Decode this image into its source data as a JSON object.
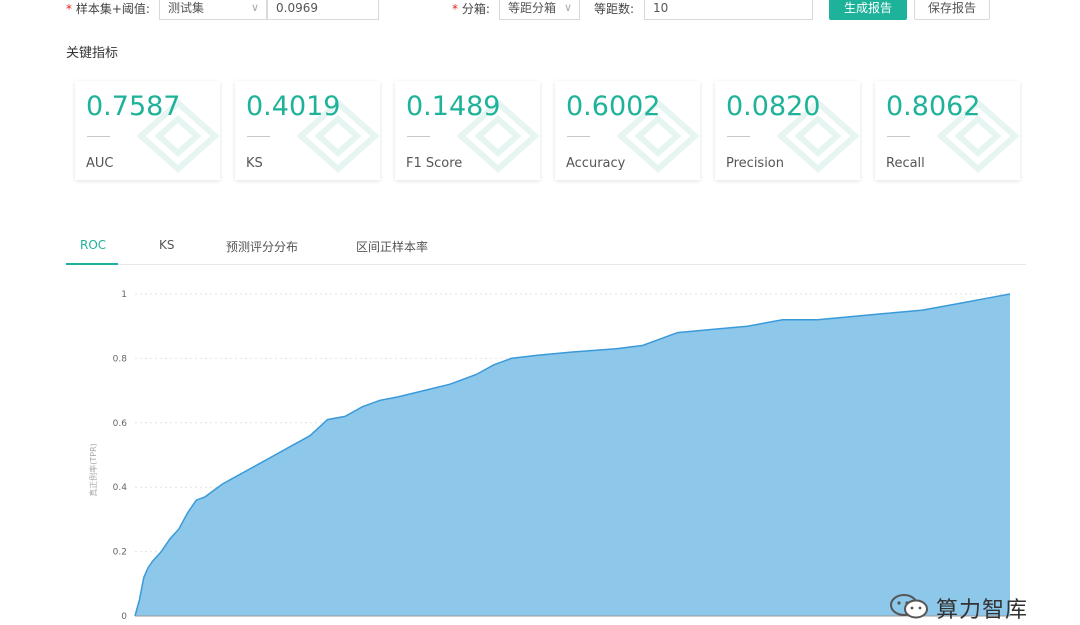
{
  "toolbar": {
    "required_mark": "*",
    "dataset_label": "样本集+阈值:",
    "dataset_value": "测试集",
    "threshold_value": "0.0969",
    "binning_label": "分箱:",
    "binning_value": "等距分箱",
    "equal_distance_label": "等距数:",
    "equal_distance_value": "10",
    "generate_button": "生成报告",
    "save_button": "保存报告"
  },
  "section_title": "关键指标",
  "metrics": [
    {
      "value": "0.7587",
      "label": "AUC"
    },
    {
      "value": "0.4019",
      "label": "KS"
    },
    {
      "value": "0.1489",
      "label": "F1 Score"
    },
    {
      "value": "0.6002",
      "label": "Accuracy"
    },
    {
      "value": "0.0820",
      "label": "Precision"
    },
    {
      "value": "0.8062",
      "label": "Recall"
    }
  ],
  "tabs": [
    {
      "label": "ROC",
      "active": true
    },
    {
      "label": "KS",
      "active": false
    },
    {
      "label": "预测评分分布",
      "active": false
    },
    {
      "label": "区间正样本率",
      "active": false
    }
  ],
  "colors": {
    "accent": "#1fb29a",
    "area_fill": "#8dc7ea",
    "area_line": "#3a9ad9",
    "required": "#e0251b"
  },
  "chart_data": {
    "type": "area",
    "ylabel": "真正例率(TPR)",
    "ylim": [
      0,
      1
    ],
    "xlim": [
      0,
      1
    ],
    "yticks": [
      "0",
      "0.2",
      "0.4",
      "0.6",
      "0.8",
      "1"
    ],
    "grid": true,
    "series": [
      {
        "x": [
          0,
          0.005,
          0.01,
          0.015,
          0.02,
          0.03,
          0.04,
          0.05,
          0.06,
          0.07,
          0.08,
          0.09,
          0.1,
          0.12,
          0.14,
          0.16,
          0.18,
          0.2,
          0.22,
          0.24,
          0.26,
          0.28,
          0.3,
          0.33,
          0.36,
          0.39,
          0.41,
          0.43,
          0.46,
          0.5,
          0.55,
          0.58,
          0.6,
          0.62,
          0.66,
          0.7,
          0.74,
          0.78,
          0.82,
          0.86,
          0.9,
          0.94,
          0.98,
          1.0
        ],
        "y": [
          0,
          0.05,
          0.12,
          0.15,
          0.17,
          0.2,
          0.24,
          0.27,
          0.32,
          0.36,
          0.37,
          0.39,
          0.41,
          0.44,
          0.47,
          0.5,
          0.53,
          0.56,
          0.61,
          0.62,
          0.65,
          0.67,
          0.68,
          0.7,
          0.72,
          0.75,
          0.78,
          0.8,
          0.81,
          0.82,
          0.83,
          0.84,
          0.86,
          0.88,
          0.89,
          0.9,
          0.92,
          0.92,
          0.93,
          0.94,
          0.95,
          0.97,
          0.99,
          1.0
        ]
      }
    ]
  },
  "watermark": {
    "text": "算力智库"
  }
}
